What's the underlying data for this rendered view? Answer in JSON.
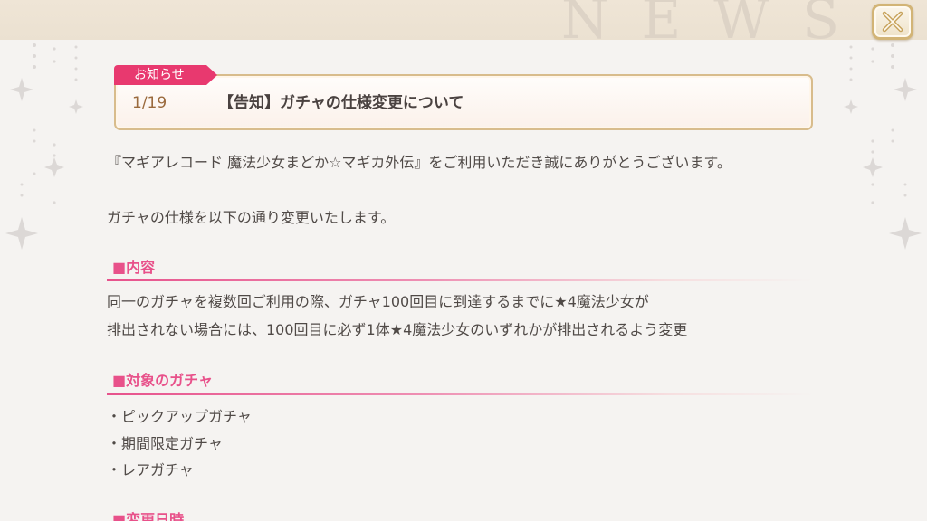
{
  "header": {
    "watermark": "NEWS",
    "close_icon": "close-x-icon"
  },
  "notice": {
    "tag": "お知らせ",
    "date": "1/19",
    "title": "【告知】ガチャの仕様変更について"
  },
  "body": {
    "intro": "『マギアレコード 魔法少女まどか☆マギカ外伝』をご利用いただき誠にありがとうございます。",
    "lead": "ガチャの仕様を以下の通り変更いたします。",
    "sections": [
      {
        "heading": "■内容",
        "lines": [
          "同一のガチャを複数回ご利用の際、ガチャ100回目に到達するまでに★4魔法少女が",
          "排出されない場合には、100回目に必ず1体★4魔法少女のいずれかが排出されるよう変更"
        ]
      },
      {
        "heading": "■対象のガチャ",
        "lines": [
          "・ピックアップガチャ",
          "・期間限定ガチャ",
          "・レアガチャ"
        ]
      },
      {
        "heading": "■変更日時",
        "lines": []
      }
    ]
  },
  "colors": {
    "accent_pink": "#e8396f",
    "gold_border": "#d8bc8c",
    "background": "#f5f3f1"
  }
}
